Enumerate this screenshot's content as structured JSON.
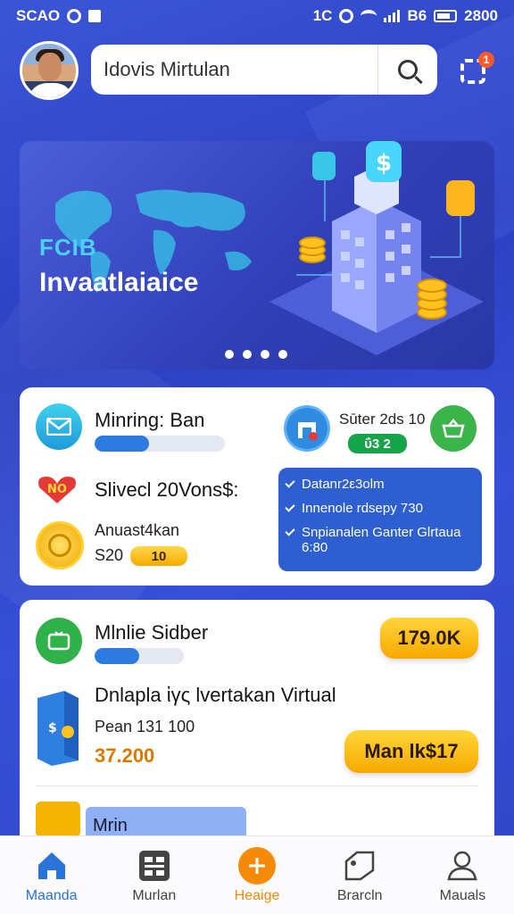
{
  "status_bar": {
    "left_text": "SCAO",
    "right_text": "1C",
    "battery": "B6",
    "time": "2800"
  },
  "header": {
    "search_value": "Idovis Mirtulan",
    "notification_count": "1"
  },
  "banner": {
    "kicker": "FCIB",
    "title": "Invaatlaiaice",
    "page_count": 4,
    "active_page": 1
  },
  "card1": {
    "mining": {
      "label": "Minring: Ban",
      "progress": 0.42
    },
    "store": {
      "label": "Sūter 2ds 10",
      "badge": "ΰ3 2"
    },
    "special": {
      "label": "Slivecl 20Vons$:"
    },
    "amount": {
      "label": "Anuast4kan",
      "value": "S20",
      "badge": "10"
    },
    "info_box": {
      "rows": [
        "Datanr2ε3olm",
        "Innenole rdsepy 730",
        "Snpianalen Ganter Glrtaua 6:80"
      ]
    }
  },
  "card2": {
    "mobile": {
      "label": "Mlnlie Sidber",
      "progress": 0.5,
      "button": "179.0K"
    },
    "product": {
      "title": "Dnlapla ἱγς lvertakan Virtual",
      "sub": "Pean 131 100",
      "price": "37.200",
      "button": "Man lk$17"
    },
    "partial": {
      "label": "Mrin"
    }
  },
  "bottom_nav": [
    {
      "label": "Maanda",
      "icon": "home-icon",
      "active": true
    },
    {
      "label": "Murlan",
      "icon": "grid-icon",
      "active": false
    },
    {
      "label": "Heaige",
      "icon": "plus-icon",
      "active": false
    },
    {
      "label": "Brarcln",
      "icon": "tag-icon",
      "active": false
    },
    {
      "label": "Mauals",
      "icon": "profile-icon",
      "active": false
    }
  ],
  "colors": {
    "primary": "#2d7ae0",
    "accent_gold": "#f7a800",
    "nav_active": "#2a73d9",
    "nav_highlight": "#f58a07"
  }
}
